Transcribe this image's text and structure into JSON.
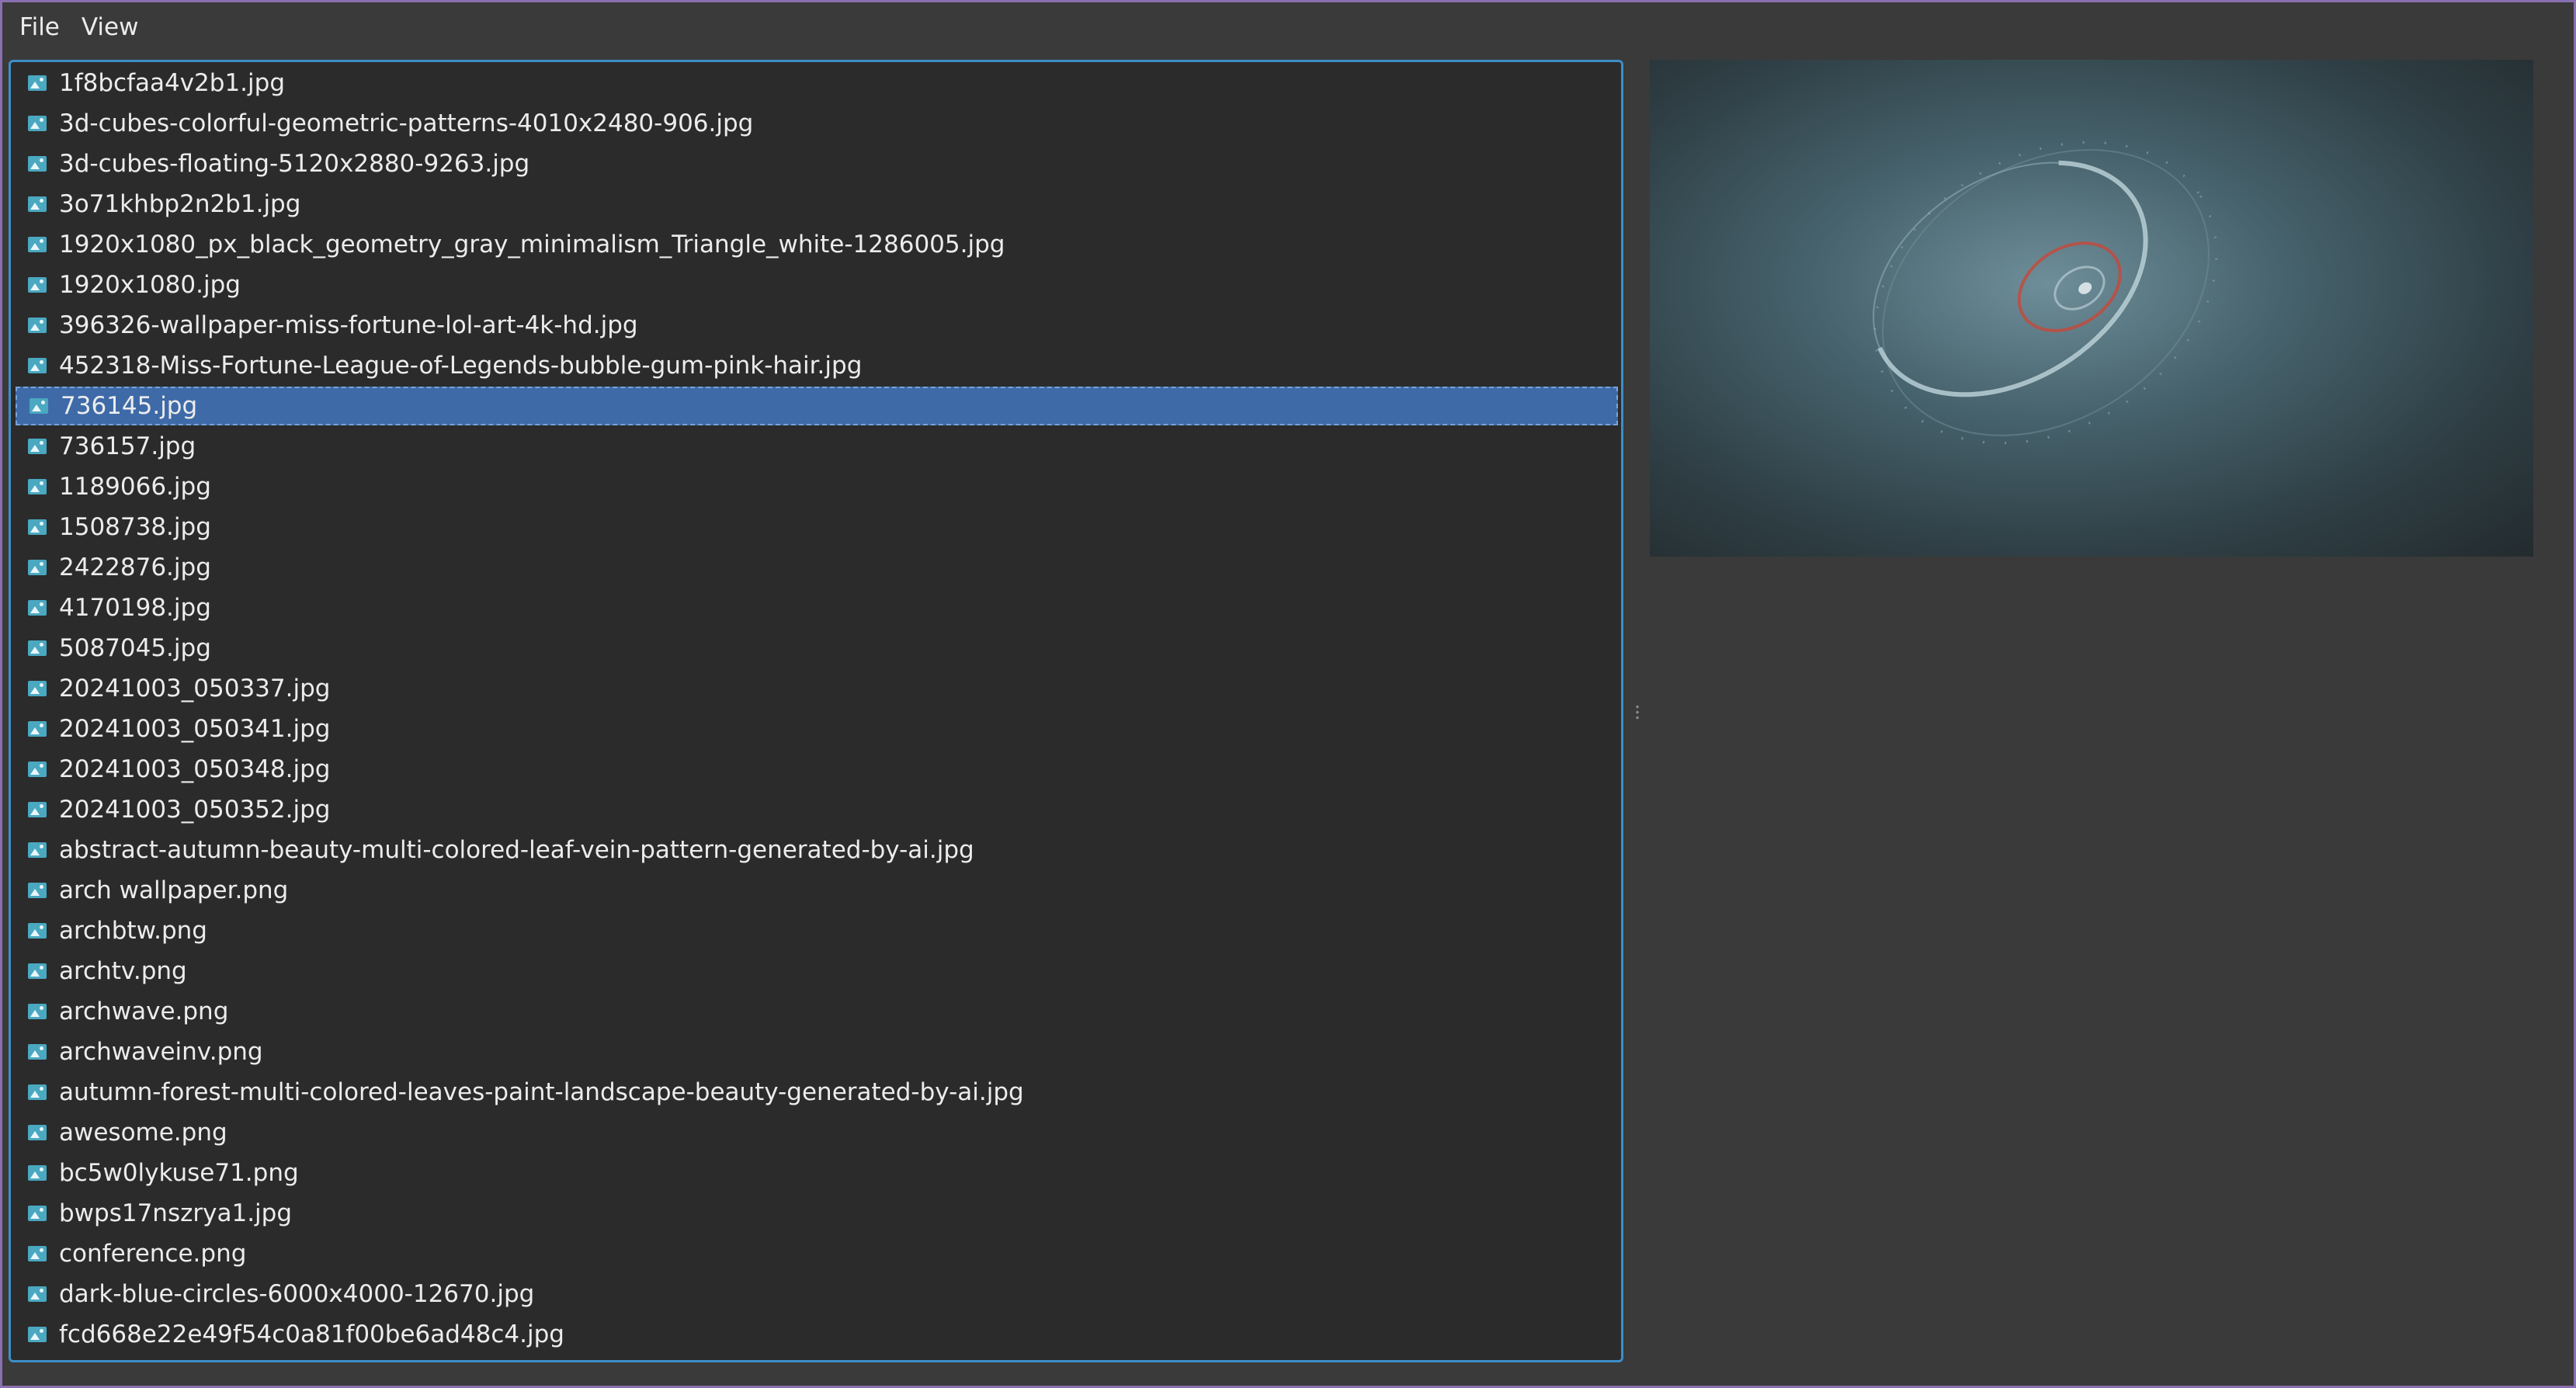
{
  "menu": {
    "file_label": "File",
    "view_label": "View"
  },
  "files": [
    "1f8bcfaa4v2b1.jpg",
    "3d-cubes-colorful-geometric-patterns-4010x2480-906.jpg",
    "3d-cubes-floating-5120x2880-9263.jpg",
    "3o71khbp2n2b1.jpg",
    "1920x1080_px_black_geometry_gray_minimalism_Triangle_white-1286005.jpg",
    "1920x1080.jpg",
    "396326-wallpaper-miss-fortune-lol-art-4k-hd.jpg",
    "452318-Miss-Fortune-League-of-Legends-bubble-gum-pink-hair.jpg",
    "736145.jpg",
    "736157.jpg",
    "1189066.jpg",
    "1508738.jpg",
    "2422876.jpg",
    "4170198.jpg",
    "5087045.jpg",
    "20241003_050337.jpg",
    "20241003_050341.jpg",
    "20241003_050348.jpg",
    "20241003_050352.jpg",
    "abstract-autumn-beauty-multi-colored-leaf-vein-pattern-generated-by-ai.jpg",
    "arch wallpaper.png",
    "archbtw.png",
    "archtv.png",
    "archwave.png",
    "archwaveinv.png",
    "autumn-forest-multi-colored-leaves-paint-landscape-beauty-generated-by-ai.jpg",
    "awesome.png",
    "bc5w0lykuse71.png",
    "bwps17nszrya1.jpg",
    "conference.png",
    "dark-blue-circles-6000x4000-12670.jpg",
    "fcd668e22e49f54c0a81f00be6ad48c4.jpg"
  ],
  "selected_file": "736145.jpg",
  "icons": {
    "file": "image-file-icon",
    "splitter": "splitter-handle-icon"
  },
  "colors": {
    "selection": "#3e6aa8",
    "focus_border": "#3d8ec9",
    "window_border": "#8a6fb0",
    "icon": "#4aa8c0"
  }
}
